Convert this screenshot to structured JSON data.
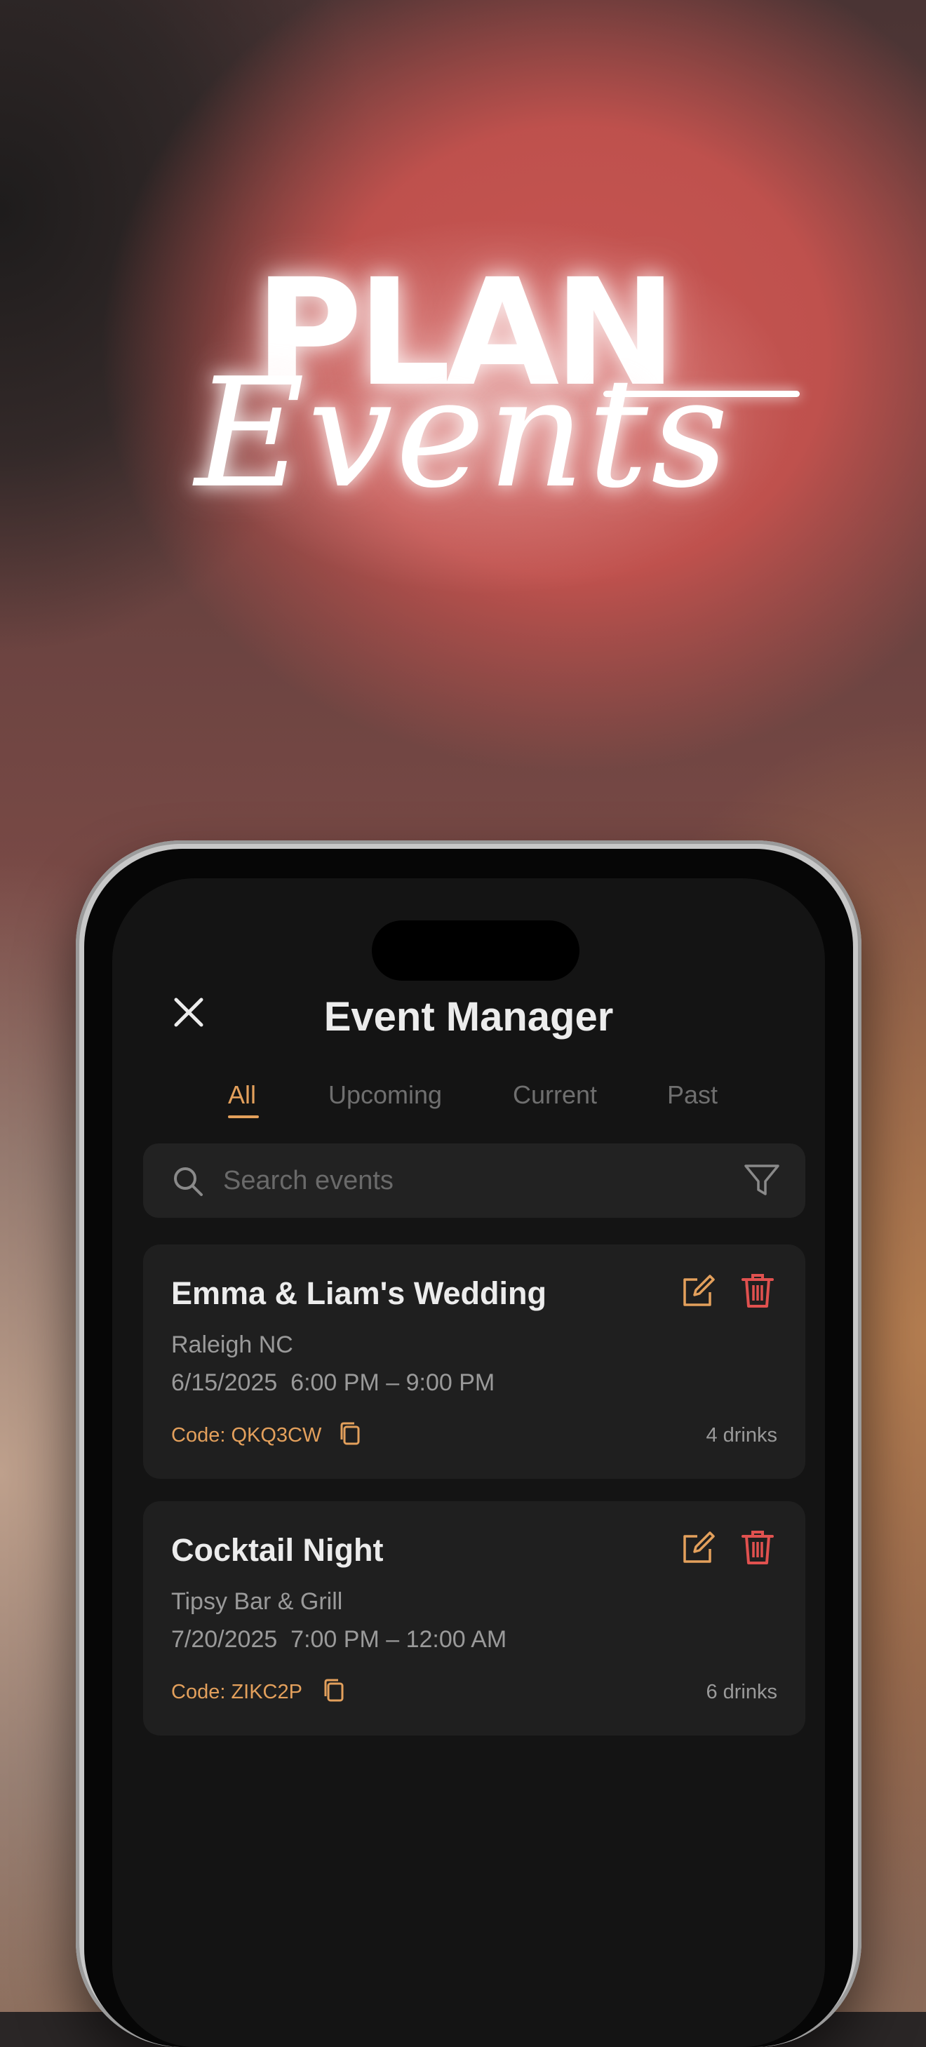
{
  "hero": {
    "line1": "PLAN",
    "line2": "Events"
  },
  "app": {
    "title": "Event Manager",
    "tabs": [
      {
        "label": "All",
        "active": true
      },
      {
        "label": "Upcoming",
        "active": false
      },
      {
        "label": "Current",
        "active": false
      },
      {
        "label": "Past",
        "active": false
      }
    ],
    "search": {
      "placeholder": "Search events"
    },
    "events": [
      {
        "name": "Emma & Liam's Wedding",
        "location": "Raleigh NC",
        "date": "6/15/2025",
        "time": "6:00 PM – 9:00 PM",
        "code": "Code: QKQ3CW",
        "drinks": "4 drinks"
      },
      {
        "name": "Cocktail Night",
        "location": "Tipsy Bar & Grill",
        "date": "7/20/2025",
        "time": "7:00 PM – 12:00 AM",
        "code": "Code: ZIKC2P",
        "drinks": "6 drinks"
      }
    ],
    "icons": {
      "close": "close-icon",
      "search": "search-icon",
      "filter": "filter-icon",
      "edit": "edit-icon",
      "delete": "trash-icon",
      "copy": "copy-icon"
    },
    "colors": {
      "accent": "#e3a05c",
      "danger": "#e0514f",
      "background": "#141414",
      "card": "#1f1f1f"
    }
  }
}
